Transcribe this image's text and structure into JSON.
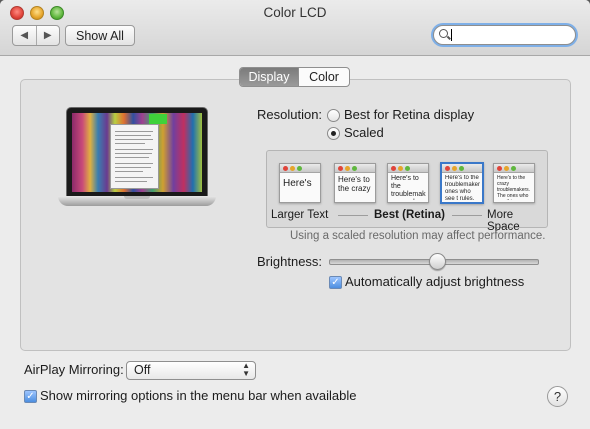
{
  "window": {
    "title": "Color LCD"
  },
  "toolbar": {
    "back_icon": "◀",
    "forward_icon": "▶",
    "show_all_label": "Show All",
    "search_placeholder": "",
    "search_value": ""
  },
  "tabs": [
    {
      "label": "Display",
      "selected": true
    },
    {
      "label": "Color",
      "selected": false
    }
  ],
  "resolution": {
    "label": "Resolution:",
    "options": [
      {
        "label": "Best for Retina display",
        "selected": false
      },
      {
        "label": "Scaled",
        "selected": true
      }
    ],
    "scaled_previews": [
      {
        "text": "Here's",
        "selected": false
      },
      {
        "text": "Here's to the crazy",
        "selected": false
      },
      {
        "text": "Here's to the troublemake ones who se",
        "selected": false
      },
      {
        "text": "Here's to the troublemakers. ones who see t rules. And the",
        "selected": true
      },
      {
        "text": "Here's to the crazy troublemakers. The ones who see things rules. And they have hem, disagree with the",
        "selected": false
      }
    ],
    "scale_labels": {
      "left": "Larger Text",
      "middle": "Best (Retina)",
      "right": "More Space"
    },
    "note": "Using a scaled resolution may affect performance."
  },
  "brightness": {
    "label": "Brightness:",
    "value_fraction": 0.52,
    "auto_adjust_label": "Automatically adjust brightness",
    "auto_adjust_checked": true
  },
  "airplay": {
    "label": "AirPlay Mirroring:",
    "selected": "Off",
    "select_arrows": "▲▼"
  },
  "mirroring_menu": {
    "label": "Show mirroring options in the menu bar when available",
    "checked": true
  },
  "help_label": "?",
  "check_glyph": "✓",
  "colors": {
    "accent": "#3a78c9",
    "close": "#e0443a",
    "minimize": "#e6a52b",
    "zoom": "#5fb73d"
  }
}
